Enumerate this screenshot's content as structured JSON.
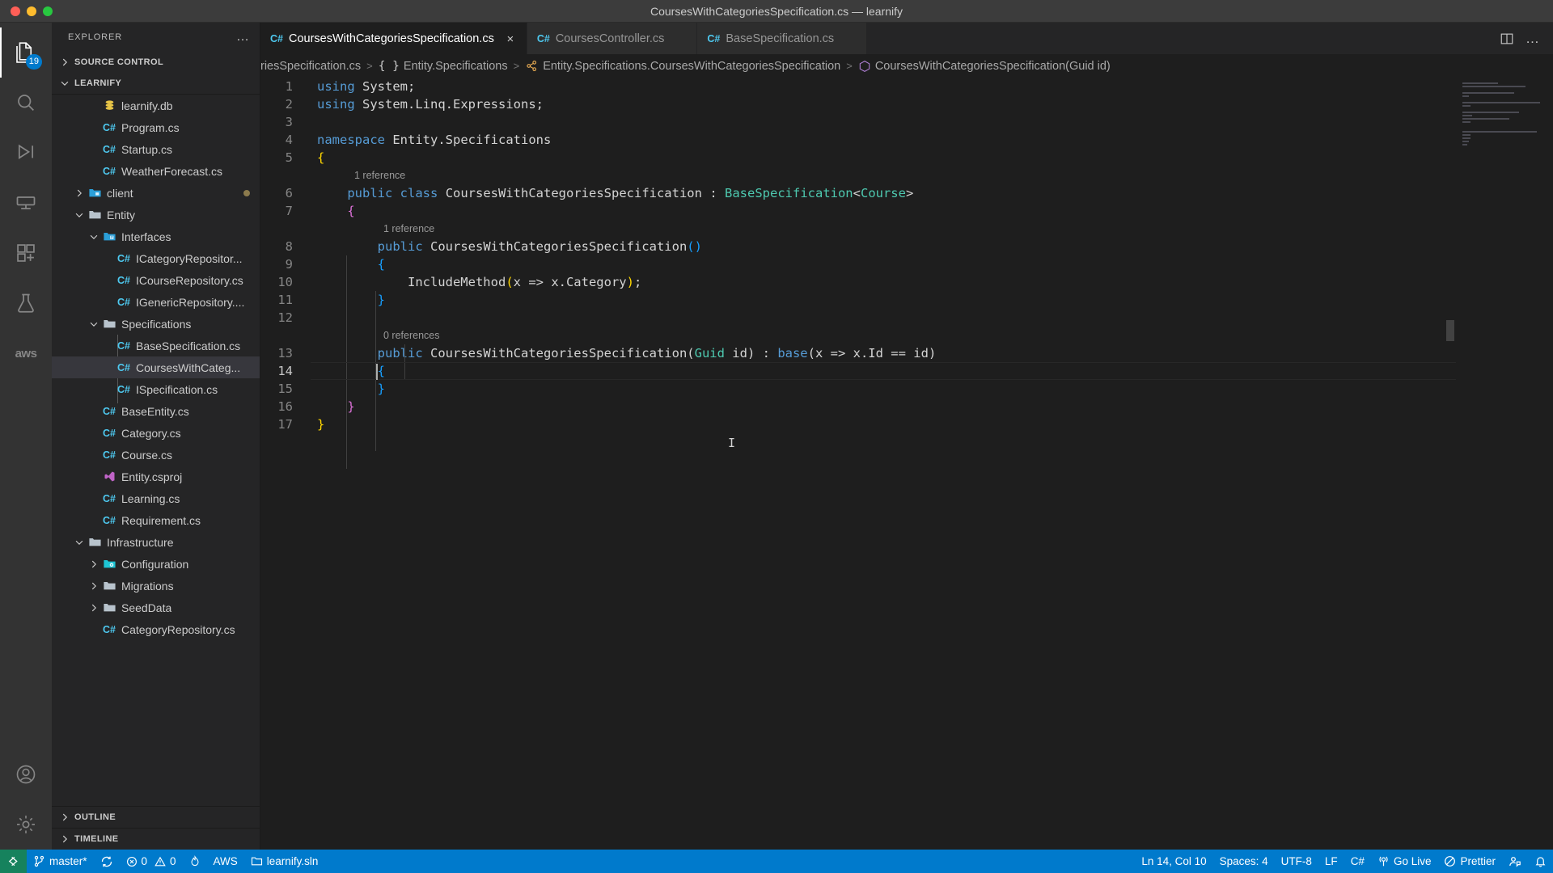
{
  "window": {
    "title": "CoursesWithCategoriesSpecification.cs — learnify",
    "traffic": {
      "close": "close-window",
      "minimize": "minimize-window",
      "maximize": "maximize-window"
    }
  },
  "activitybar": {
    "items": [
      {
        "name": "explorer",
        "icon": "files-icon",
        "badge": "19",
        "active": true
      },
      {
        "name": "search",
        "icon": "search-icon",
        "badge": ""
      },
      {
        "name": "run-and-debug",
        "icon": "debug-icon",
        "badge": ""
      },
      {
        "name": "remote-explorer",
        "icon": "remote-icon",
        "badge": ""
      },
      {
        "name": "extensions",
        "icon": "extensions-icon",
        "badge": ""
      },
      {
        "name": "testing",
        "icon": "beaker-icon",
        "badge": ""
      },
      {
        "name": "aws-toolkit",
        "icon": "aws-icon",
        "badge": ""
      }
    ],
    "bottom": [
      {
        "name": "accounts",
        "icon": "account-icon"
      },
      {
        "name": "manage",
        "icon": "gear-icon"
      }
    ]
  },
  "sidebar": {
    "title": "EXPLORER",
    "more_label": "…",
    "sections": [
      {
        "label": "SOURCE CONTROL",
        "expanded": false
      },
      {
        "label": "LEARNIFY",
        "expanded": true
      }
    ],
    "footer_sections": [
      {
        "label": "OUTLINE",
        "expanded": false
      },
      {
        "label": "TIMELINE",
        "expanded": false
      }
    ],
    "tree": [
      {
        "label": "learnify.db",
        "icon": "database-icon",
        "indent": 3,
        "twisty": "",
        "selected": false,
        "modified": false
      },
      {
        "label": "Program.cs",
        "icon": "csharp-icon",
        "indent": 3,
        "twisty": "",
        "selected": false,
        "modified": false
      },
      {
        "label": "Startup.cs",
        "icon": "csharp-icon",
        "indent": 3,
        "twisty": "",
        "selected": false,
        "modified": false
      },
      {
        "label": "WeatherForecast.cs",
        "icon": "csharp-icon",
        "indent": 3,
        "twisty": "",
        "selected": false,
        "modified": false
      },
      {
        "label": "client",
        "icon": "folder-src-icon",
        "indent": 2,
        "twisty": "right",
        "selected": false,
        "modified": true
      },
      {
        "label": "Entity",
        "icon": "folder-icon",
        "indent": 2,
        "twisty": "down",
        "selected": false,
        "modified": false
      },
      {
        "label": "Interfaces",
        "icon": "folder-iface-icon",
        "indent": 3,
        "twisty": "down",
        "selected": false,
        "modified": false
      },
      {
        "label": "ICategoryRepositor...",
        "icon": "csharp-icon",
        "indent": 4,
        "twisty": "",
        "selected": false,
        "modified": false
      },
      {
        "label": "ICourseRepository.cs",
        "icon": "csharp-icon",
        "indent": 4,
        "twisty": "",
        "selected": false,
        "modified": false
      },
      {
        "label": "IGenericRepository....",
        "icon": "csharp-icon",
        "indent": 4,
        "twisty": "",
        "selected": false,
        "modified": false
      },
      {
        "label": "Specifications",
        "icon": "folder-icon",
        "indent": 3,
        "twisty": "down",
        "selected": false,
        "modified": false
      },
      {
        "label": "BaseSpecification.cs",
        "icon": "csharp-icon",
        "indent": 4,
        "twisty": "",
        "selected": false,
        "modified": false
      },
      {
        "label": "CoursesWithCateg...",
        "icon": "csharp-icon",
        "indent": 4,
        "twisty": "",
        "selected": true,
        "modified": false
      },
      {
        "label": "ISpecification.cs",
        "icon": "csharp-icon",
        "indent": 4,
        "twisty": "",
        "selected": false,
        "modified": false
      },
      {
        "label": "BaseEntity.cs",
        "icon": "csharp-icon",
        "indent": 3,
        "twisty": "",
        "selected": false,
        "modified": false
      },
      {
        "label": "Category.cs",
        "icon": "csharp-icon",
        "indent": 3,
        "twisty": "",
        "selected": false,
        "modified": false
      },
      {
        "label": "Course.cs",
        "icon": "csharp-icon",
        "indent": 3,
        "twisty": "",
        "selected": false,
        "modified": false
      },
      {
        "label": "Entity.csproj",
        "icon": "vs-icon",
        "indent": 3,
        "twisty": "",
        "selected": false,
        "modified": false
      },
      {
        "label": "Learning.cs",
        "icon": "csharp-icon",
        "indent": 3,
        "twisty": "",
        "selected": false,
        "modified": false
      },
      {
        "label": "Requirement.cs",
        "icon": "csharp-icon",
        "indent": 3,
        "twisty": "",
        "selected": false,
        "modified": false
      },
      {
        "label": "Infrastructure",
        "icon": "folder-icon",
        "indent": 2,
        "twisty": "down",
        "selected": false,
        "modified": false
      },
      {
        "label": "Configuration",
        "icon": "folder-cfg-icon",
        "indent": 3,
        "twisty": "right",
        "selected": false,
        "modified": false
      },
      {
        "label": "Migrations",
        "icon": "folder-icon",
        "indent": 3,
        "twisty": "right",
        "selected": false,
        "modified": false
      },
      {
        "label": "SeedData",
        "icon": "folder-icon",
        "indent": 3,
        "twisty": "right",
        "selected": false,
        "modified": false
      },
      {
        "label": "CategoryRepository.cs",
        "icon": "csharp-icon",
        "indent": 3,
        "twisty": "",
        "selected": false,
        "modified": false
      }
    ]
  },
  "tabs": [
    {
      "label": "CoursesWithCategoriesSpecification.cs",
      "icon": "csharp-icon",
      "active": true,
      "close_label": "×"
    },
    {
      "label": "CoursesController.cs",
      "icon": "csharp-icon",
      "active": false,
      "close_label": "×"
    },
    {
      "label": "BaseSpecification.cs",
      "icon": "csharp-icon",
      "active": false,
      "close_label": "×"
    }
  ],
  "tab_actions": [
    {
      "name": "split-editor-icon"
    },
    {
      "name": "more-actions-icon",
      "label": "…"
    }
  ],
  "breadcrumbs": [
    {
      "label": "riesSpecification.cs",
      "icon": ""
    },
    {
      "label": "Entity.Specifications",
      "icon": "namespace-icon"
    },
    {
      "label": "Entity.Specifications.CoursesWithCategoriesSpecification",
      "icon": "class-icon"
    },
    {
      "label": "CoursesWithCategoriesSpecification(Guid id)",
      "icon": "method-icon"
    }
  ],
  "editor": {
    "language": "C#",
    "lines": [
      {
        "n": 1,
        "text": "using System;"
      },
      {
        "n": 2,
        "text": "using System.Linq.Expressions;"
      },
      {
        "n": 3,
        "text": ""
      },
      {
        "n": 4,
        "text": "namespace Entity.Specifications"
      },
      {
        "n": 5,
        "text": "{"
      },
      {
        "n": "",
        "text": "1 reference",
        "codelens": true
      },
      {
        "n": 6,
        "text": "    public class CoursesWithCategoriesSpecification : BaseSpecification<Course>"
      },
      {
        "n": 7,
        "text": "    {"
      },
      {
        "n": "",
        "text": "1 reference",
        "codelens": true
      },
      {
        "n": 8,
        "text": "        public CoursesWithCategoriesSpecification()"
      },
      {
        "n": 9,
        "text": "        {"
      },
      {
        "n": 10,
        "text": "            IncludeMethod(x => x.Category);"
      },
      {
        "n": 11,
        "text": "        }"
      },
      {
        "n": 12,
        "text": ""
      },
      {
        "n": "",
        "text": "0 references",
        "codelens": true
      },
      {
        "n": 13,
        "text": "        public CoursesWithCategoriesSpecification(Guid id) : base(x => x.Id == id)"
      },
      {
        "n": 14,
        "text": "        {"
      },
      {
        "n": 15,
        "text": "        }"
      },
      {
        "n": 16,
        "text": "    }"
      },
      {
        "n": 17,
        "text": "}"
      }
    ],
    "codelens": {
      "one_reference": "1 reference",
      "zero_references": "0 references"
    }
  },
  "statusbar": {
    "left": [
      {
        "name": "remote-host",
        "label": "",
        "icon": "remote-icon"
      },
      {
        "name": "branch",
        "label": "master*",
        "icon": "source-control-icon"
      },
      {
        "name": "sync",
        "label": "",
        "icon": "sync-icon"
      },
      {
        "name": "problems",
        "label": "0  0",
        "errors": "0",
        "warnings": "0",
        "icon": "error-warning-icon"
      },
      {
        "name": "radon",
        "label": "",
        "icon": "flame-icon"
      },
      {
        "name": "aws-connection",
        "label": "AWS",
        "icon": ""
      },
      {
        "name": "solution",
        "label": "learnify.sln",
        "icon": "folder-icon"
      }
    ],
    "right": [
      {
        "name": "cursor-position",
        "label": "Ln 14, Col 10"
      },
      {
        "name": "indentation",
        "label": "Spaces: 4"
      },
      {
        "name": "encoding",
        "label": "UTF-8"
      },
      {
        "name": "eol",
        "label": "LF"
      },
      {
        "name": "language-mode",
        "label": "C#"
      },
      {
        "name": "go-live",
        "label": "Go Live",
        "icon": "broadcast-icon"
      },
      {
        "name": "prettier",
        "label": "Prettier",
        "icon": "prettier-icon"
      },
      {
        "name": "live-share",
        "label": "",
        "icon": "live-share-icon"
      },
      {
        "name": "notifications",
        "label": "",
        "icon": "bell-icon"
      }
    ]
  },
  "colors": {
    "accent": "#007acc",
    "remote_green": "#16825d",
    "editor_bg": "#1e1e1e",
    "sidebar_bg": "#252526",
    "activitybar_bg": "#333333",
    "titlebar_bg": "#3c3c3c",
    "selection": "#37373d"
  }
}
